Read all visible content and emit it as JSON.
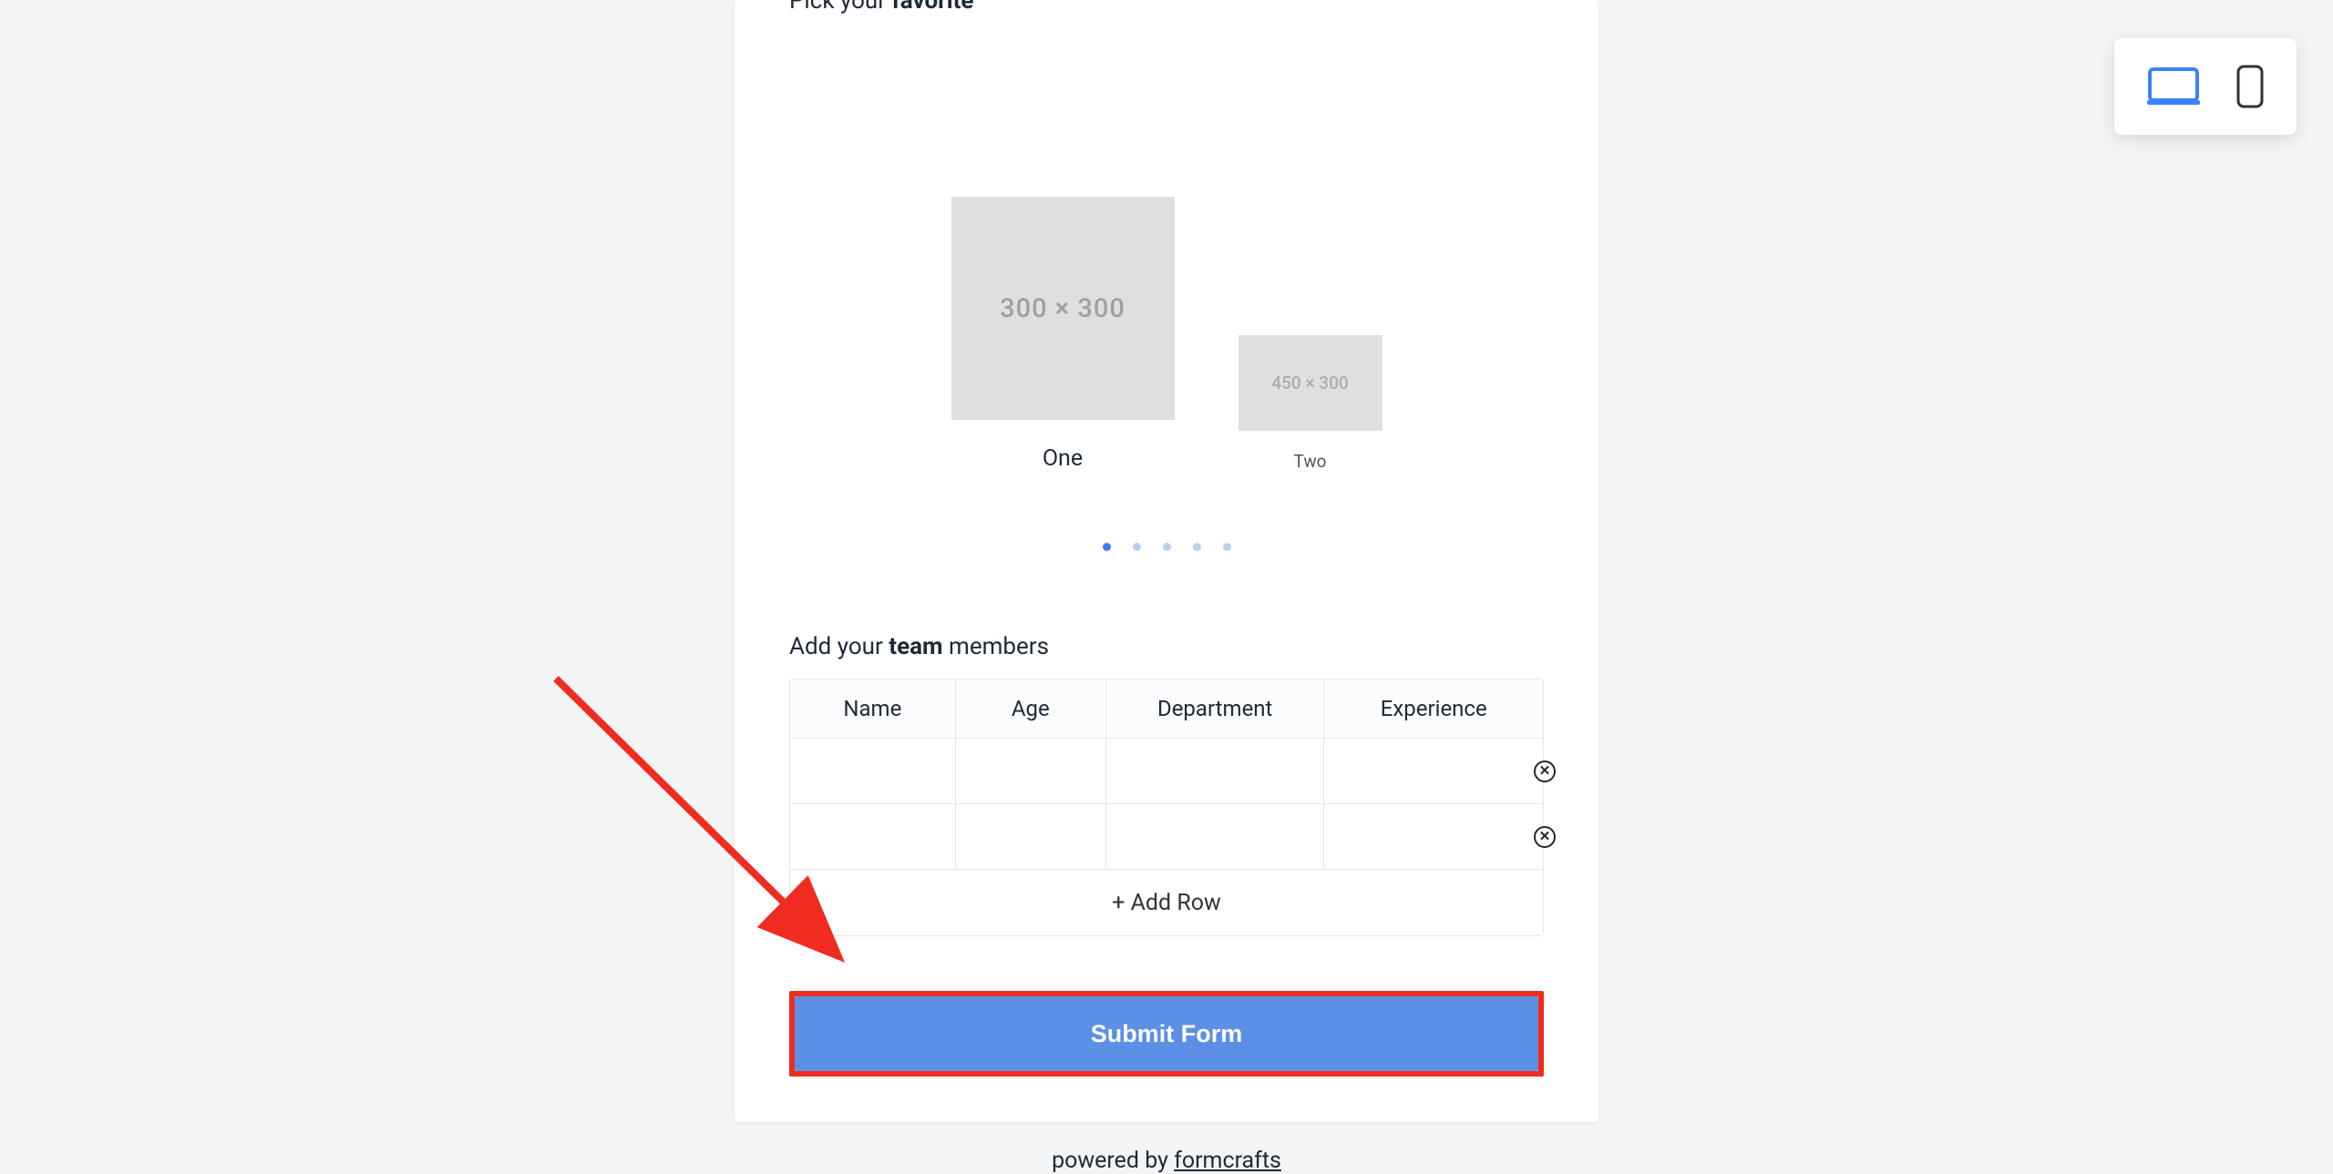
{
  "favorite": {
    "label_prefix": "Pick your ",
    "label_bold": "favorite",
    "label_suffix": "",
    "items": [
      {
        "placeholder": "300 × 300",
        "caption": "One"
      },
      {
        "placeholder": "450 × 300",
        "caption": "Two"
      }
    ],
    "dot_count": 5,
    "active_dot": 0
  },
  "team": {
    "label_prefix": "Add your ",
    "label_bold": "team",
    "label_suffix": " members",
    "columns": [
      "Name",
      "Age",
      "Department",
      "Experience"
    ],
    "rows": [
      {
        "name": "",
        "age": "",
        "department": "",
        "experience": ""
      },
      {
        "name": "",
        "age": "",
        "department": "",
        "experience": ""
      }
    ],
    "add_row_label": "+ Add Row"
  },
  "submit": {
    "label": "Submit Form"
  },
  "footer": {
    "prefix": "powered by ",
    "link_text": "formcrafts"
  },
  "device_toggle": {
    "active": "desktop"
  },
  "annotation": {
    "type": "arrow",
    "target": "submit-button",
    "color": "#ef2c1f"
  }
}
